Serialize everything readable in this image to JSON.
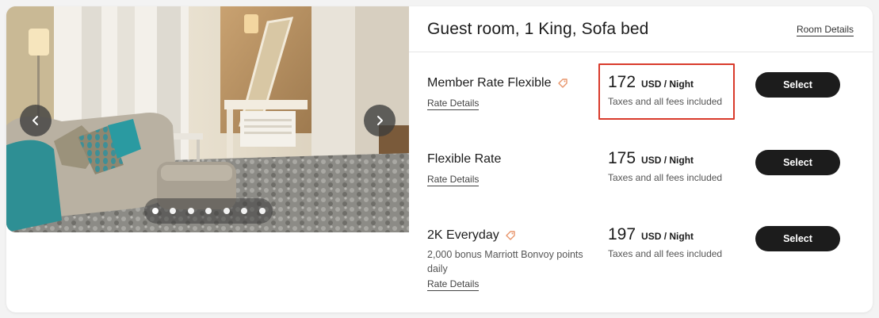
{
  "room": {
    "title": "Guest room, 1 King, Sofa bed",
    "details_link": "Room Details"
  },
  "gallery": {
    "prev_icon": "chevron-left-icon",
    "next_icon": "chevron-right-icon",
    "photo_count": 7,
    "active_index": 0
  },
  "rates": [
    {
      "name": "Member Rate Flexible",
      "tag_icon": "tag-icon",
      "description": "",
      "details_link": "Rate Details",
      "price": "172",
      "unit": "USD / Night",
      "note": "Taxes and all fees included",
      "button": "Select"
    },
    {
      "name": "Flexible Rate",
      "tag_icon": "",
      "description": "",
      "details_link": "Rate Details",
      "price": "175",
      "unit": "USD / Night",
      "note": "Taxes and all fees included",
      "button": "Select"
    },
    {
      "name": "2K Everyday",
      "tag_icon": "tag-icon",
      "description": "2,000 bonus Marriott Bonvoy points daily",
      "details_link": "Rate Details",
      "price": "197",
      "unit": "USD / Night",
      "note": "Taxes and all fees included",
      "button": "Select"
    }
  ],
  "colors": {
    "button": "#1c1c1c",
    "highlight": "#d93a2b",
    "tag": "#e8956b"
  }
}
